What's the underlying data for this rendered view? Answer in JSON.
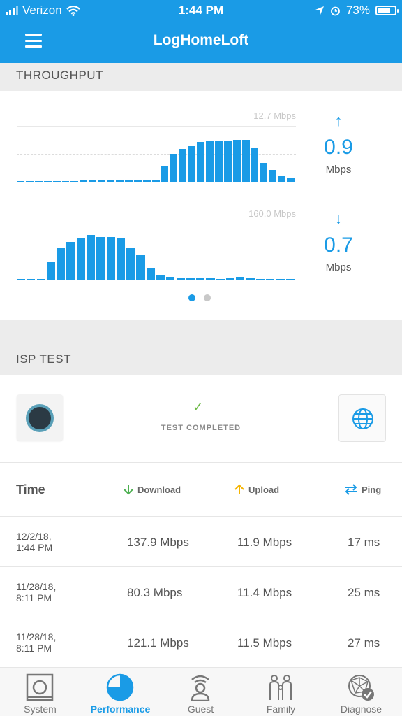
{
  "status": {
    "carrier": "Verizon",
    "time": "1:44 PM",
    "battery": "73%"
  },
  "nav": {
    "title": "LogHomeLoft"
  },
  "throughput": {
    "heading": "THROUGHPUT",
    "upload_chart": {
      "max_label": "12.7 Mbps",
      "arrow": "↑",
      "value": "0.9",
      "unit": "Mbps"
    },
    "download_chart": {
      "max_label": "160.0 Mbps",
      "arrow": "↓",
      "value": "0.7",
      "unit": "Mbps"
    }
  },
  "chart_data": [
    {
      "type": "bar",
      "ylim": [
        0,
        12.7
      ],
      "values": [
        0.2,
        0.2,
        0.2,
        0.3,
        0.3,
        0.3,
        0.3,
        0.5,
        0.5,
        0.5,
        0.5,
        0.5,
        0.7,
        0.7,
        0.5,
        0.5,
        3.6,
        6.5,
        7.6,
        8.3,
        9.2,
        9.4,
        9.5,
        9.6,
        9.7,
        9.7,
        8.0,
        4.5,
        2.8,
        1.5,
        1.0
      ]
    },
    {
      "type": "bar",
      "ylim": [
        0,
        160.0
      ],
      "values": [
        0,
        2,
        5,
        55,
        95,
        110,
        122,
        130,
        125,
        125,
        123,
        95,
        72,
        35,
        15,
        10,
        9,
        6,
        9,
        6,
        5,
        6,
        10,
        7,
        5,
        3,
        3,
        2
      ]
    }
  ],
  "isp_test": {
    "heading": "ISP TEST",
    "check": "✓",
    "status": "TEST COMPLETED"
  },
  "table": {
    "headers": {
      "time": "Time",
      "download": "Download",
      "upload": "Upload",
      "ping": "Ping"
    },
    "rows": [
      {
        "date_line1": "12/2/18,",
        "date_line2": "1:44 PM",
        "download": "137.9 Mbps",
        "upload": "11.9 Mbps",
        "ping": "17 ms"
      },
      {
        "date_line1": "11/28/18,",
        "date_line2": "8:11 PM",
        "download": "80.3 Mbps",
        "upload": "11.4 Mbps",
        "ping": "25 ms"
      },
      {
        "date_line1": "11/28/18,",
        "date_line2": "8:11 PM",
        "download": "121.1 Mbps",
        "upload": "11.5 Mbps",
        "ping": "27 ms"
      }
    ]
  },
  "tabs": [
    {
      "label": "System",
      "icon": "router-icon"
    },
    {
      "label": "Performance",
      "icon": "pie-gauge-icon"
    },
    {
      "label": "Guest",
      "icon": "guest-icon"
    },
    {
      "label": "Family",
      "icon": "family-icon"
    },
    {
      "label": "Diagnose",
      "icon": "diagnose-icon"
    }
  ],
  "colors": {
    "brand": "#1a9be6",
    "check": "#6bb944",
    "download_arrow": "#4caf50",
    "upload_arrow": "#f5b400"
  }
}
